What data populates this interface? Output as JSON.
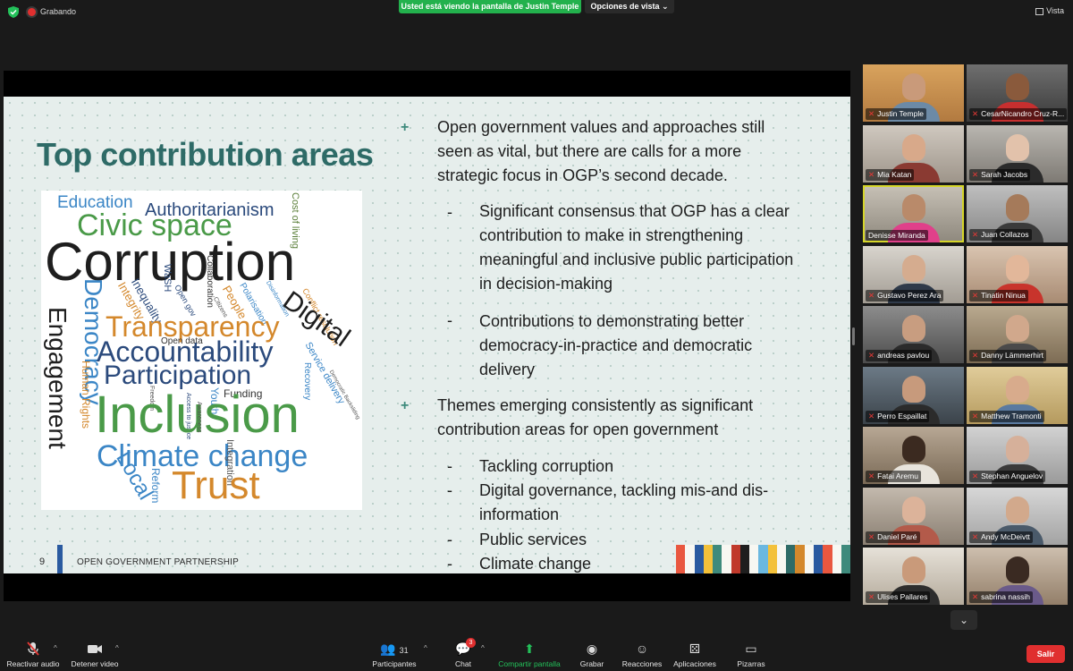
{
  "topbar": {
    "recording_label": "Grabando",
    "viewing_banner": "Usted está viendo la pantalla de Justin Temple",
    "view_options": "Opciones de vista ⌄",
    "view_label": "Vista"
  },
  "slide": {
    "title": "Top contribution areas",
    "bullet1": "Open government values and approaches still seen as vital, but there are calls for a more strategic focus in OGP’s second decade.",
    "sub1": "Significant consensus that OGP has a clear contribution to make in strengthening meaningful and inclusive public participation in decision-making",
    "sub2": "Contributions to demonstrating better democracy-in-practice and democratic delivery",
    "bullet2": "Themes emerging consistently as significant contribution areas for open government",
    "theme1": "Tackling corruption",
    "theme2": "Digital governance, tackling mis-and dis-information",
    "theme3": "Public services",
    "theme4": "Climate change",
    "dash": "-",
    "plus": "+",
    "page_number": "9",
    "org_name": "OPEN GOVERNMENT PARTNERSHIP"
  },
  "wordcloud": {
    "words": [
      "Education",
      "Authoritarianism",
      "Cost of living",
      "Civic space",
      "Corruption",
      "WaSH",
      "Collaboration",
      "Inequality",
      "Open gov",
      "Integrity",
      "People",
      "Polarisation",
      "Disinformation",
      "Conflict resolution",
      "Digital",
      "Democracy",
      "Engagement",
      "Transparency",
      "Citizens",
      "Service delivery",
      "Open data",
      "Accountability",
      "Human Rights",
      "Recovery",
      "Participation",
      "Democratic Backsliding",
      "Freedom",
      "Access to justice",
      "Youth",
      "Funding",
      "Inclusion",
      "Awareness",
      "Local",
      "Climate change",
      "Integration",
      "Reform",
      "Trust"
    ]
  },
  "participants": [
    {
      "name": "Justin Temple"
    },
    {
      "name": "CesarNicandro Cruz-R..."
    },
    {
      "name": "Mia Katan"
    },
    {
      "name": "Sarah Jacobs"
    },
    {
      "name": "Denisse Miranda"
    },
    {
      "name": "Juan Collazos"
    },
    {
      "name": "Gustavo Perez Ara"
    },
    {
      "name": "Tinatin Ninua"
    },
    {
      "name": "andreas pavlou"
    },
    {
      "name": "Danny Lämmerhirt"
    },
    {
      "name": "Perro Espaillat"
    },
    {
      "name": "Matthew Tramonti"
    },
    {
      "name": "Fatai Aremu"
    },
    {
      "name": "Stephan Anguelov"
    },
    {
      "name": "Daniel Paré"
    },
    {
      "name": "Andy McDeivtt"
    },
    {
      "name": "Ulises Pallares"
    },
    {
      "name": "sabrina nassih"
    }
  ],
  "toolbar": {
    "unmute": "Reactivar audio",
    "stop_video": "Detener video",
    "participants": "Participantes",
    "participants_count": "31",
    "chat": "Chat",
    "chat_badge": "3",
    "share": "Compartir pantalla",
    "record": "Grabar",
    "reactions": "Reacciones",
    "apps": "Aplicaciones",
    "whiteboards": "Pizarras",
    "leave": "Salir"
  }
}
